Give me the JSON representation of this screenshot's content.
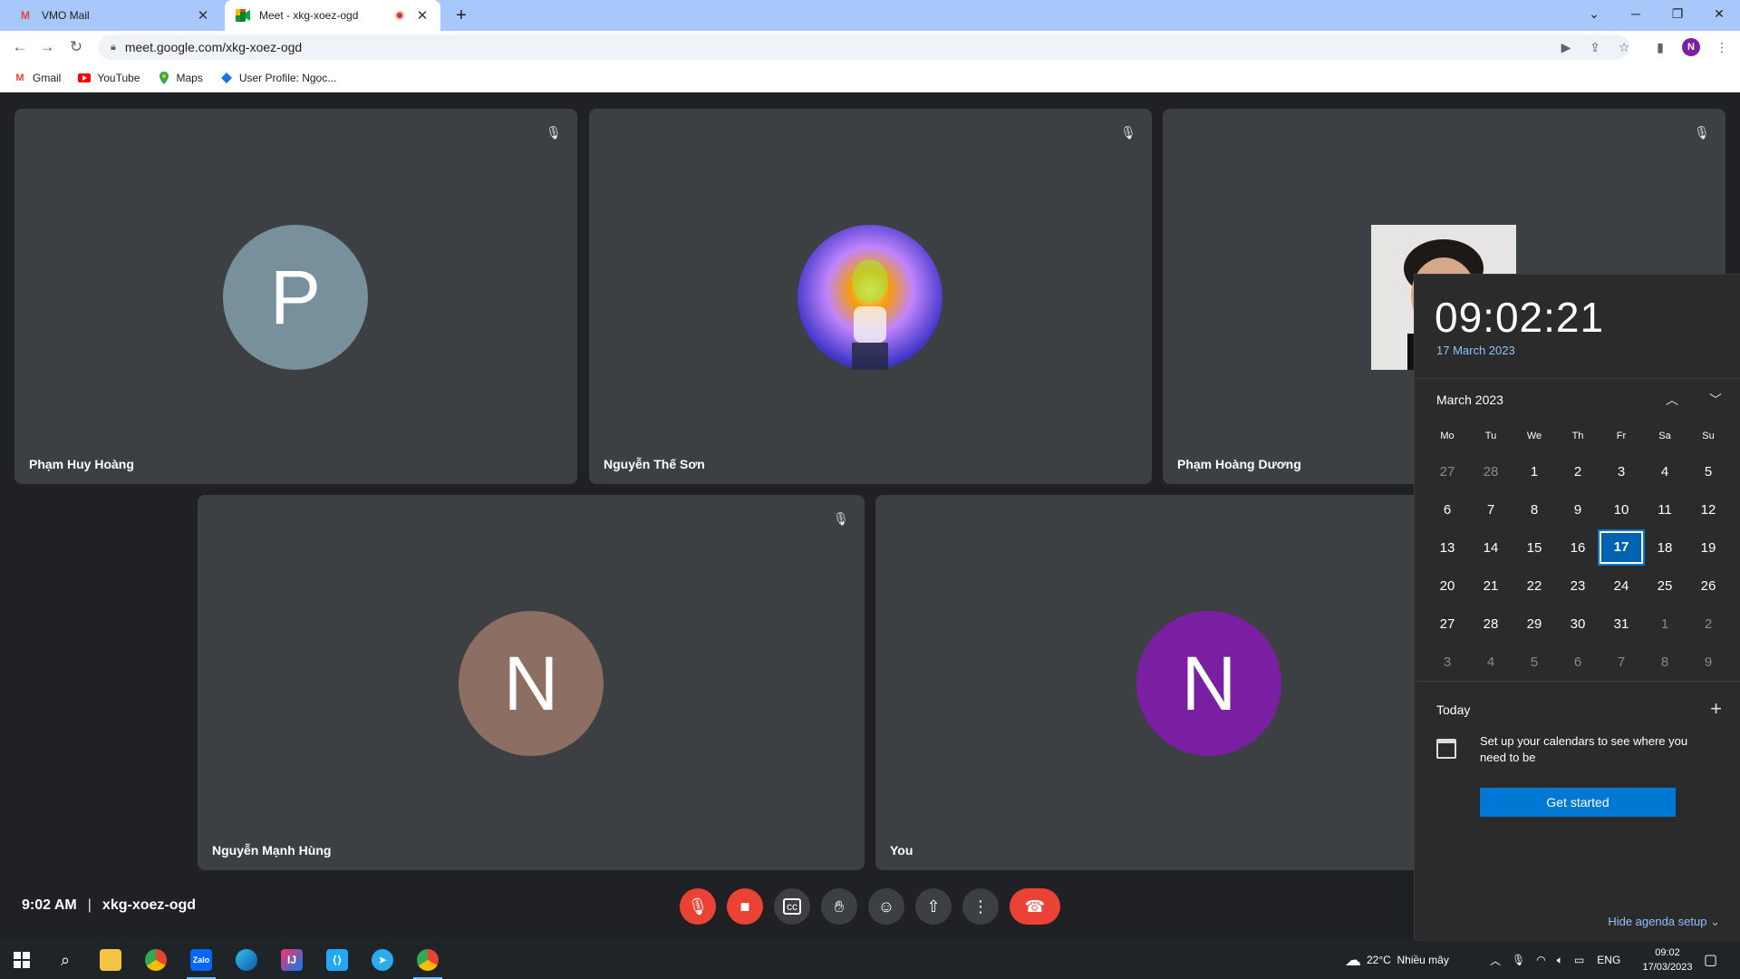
{
  "browser": {
    "tabs": [
      {
        "title": "VMO Mail",
        "icon": "gmail-icon"
      },
      {
        "title": "Meet - xkg-xoez-ogd",
        "icon": "meet-icon",
        "recording": true
      }
    ],
    "url": "meet.google.com/xkg-xoez-ogd",
    "profile_initial": "N",
    "bookmarks": [
      {
        "label": "Gmail",
        "icon": "gmail-icon",
        "color": "#ea4335"
      },
      {
        "label": "YouTube",
        "icon": "youtube-icon",
        "color": "#ff0000"
      },
      {
        "label": "Maps",
        "icon": "maps-icon",
        "color": "#34a853"
      },
      {
        "label": "User Profile: Ngọc...",
        "icon": "profile-diamond-icon",
        "color": "#1a73e8"
      }
    ]
  },
  "meet": {
    "participants": [
      {
        "name": "Phạm Huy Hoàng",
        "initial": "P",
        "avatar_color": "#78909c",
        "muted": true
      },
      {
        "name": "Nguyễn Thế Sơn",
        "initial": "",
        "avatar_color": "#7e57c2",
        "muted": true,
        "photo": true
      },
      {
        "name": "Phạm Hoàng Dương",
        "initial": "",
        "avatar_color": "#d7d2cc",
        "muted": true,
        "photo": true
      },
      {
        "name": "Nguyễn Mạnh Hùng",
        "initial": "N",
        "avatar_color": "#8d6e63",
        "muted": true
      },
      {
        "name": "You",
        "initial": "N",
        "avatar_color": "#7b1fa2",
        "muted": false
      }
    ],
    "time": "9:02 AM",
    "separator": "|",
    "meeting_code": "xkg-xoez-ogd"
  },
  "calendar": {
    "time": "09:02:21",
    "date": "17 March 2023",
    "month_label": "March 2023",
    "weekdays": [
      "Mo",
      "Tu",
      "We",
      "Th",
      "Fr",
      "Sa",
      "Su"
    ],
    "weeks": [
      [
        "27",
        "28",
        "1",
        "2",
        "3",
        "4",
        "5"
      ],
      [
        "6",
        "7",
        "8",
        "9",
        "10",
        "11",
        "12"
      ],
      [
        "13",
        "14",
        "15",
        "16",
        "17",
        "18",
        "19"
      ],
      [
        "20",
        "21",
        "22",
        "23",
        "24",
        "25",
        "26"
      ],
      [
        "27",
        "28",
        "29",
        "30",
        "31",
        "1",
        "2"
      ],
      [
        "3",
        "4",
        "5",
        "6",
        "7",
        "8",
        "9"
      ]
    ],
    "today_label": "Today",
    "agenda_text": "Set up your calendars to see where you need to be",
    "get_started": "Get started",
    "hide_agenda": "Hide agenda setup"
  },
  "taskbar": {
    "weather": "22°C  Nhiều mây",
    "language": "ENG",
    "clock_time": "09:02",
    "clock_date": "17/03/2023"
  }
}
